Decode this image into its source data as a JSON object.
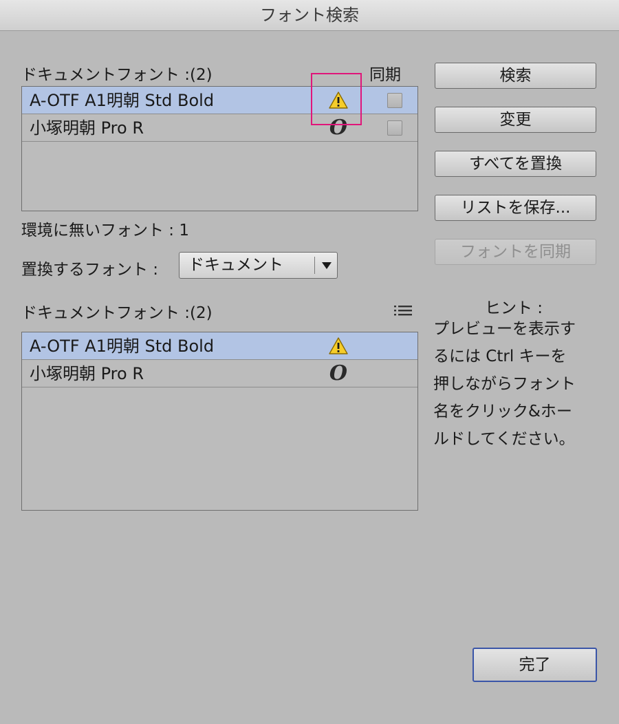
{
  "window": {
    "title": "フォント検索"
  },
  "top_list": {
    "header": "ドキュメントフォント :(2)",
    "sync_header": "同期",
    "rows": [
      {
        "name": "A-OTF A1明朝 Std Bold",
        "icon": "warning-triangle-icon",
        "selected": true
      },
      {
        "name": "小塚明朝 Pro R",
        "icon": "opentype-font-icon",
        "selected": false
      }
    ]
  },
  "missing_fonts_label": "環境に無いフォント : 1",
  "replace_with": {
    "label": "置換するフォント :",
    "selected": "ドキュメント"
  },
  "bottom_list": {
    "header": "ドキュメントフォント :(2)",
    "menu_icon": "list-menu-icon",
    "rows": [
      {
        "name": "A-OTF A1明朝 Std Bold",
        "icon": "warning-triangle-icon",
        "selected": true
      },
      {
        "name": "小塚明朝 Pro R",
        "icon": "opentype-font-icon",
        "selected": false
      }
    ]
  },
  "buttons": {
    "search": "検索",
    "change": "変更",
    "replace_all": "すべてを置換",
    "save_list": "リストを保存...",
    "sync_fonts": "フォントを同期",
    "done": "完了"
  },
  "hint": {
    "title": "ヒント :",
    "text": "プレビューを表示す\nるには Ctrl キーを\n押しながらフォント\n名をクリック&ホー\nルドしてください。"
  },
  "colors": {
    "selection": "#b2c4e4",
    "annotation_box": "#e0157a",
    "default_button_border": "#3a55a8"
  }
}
